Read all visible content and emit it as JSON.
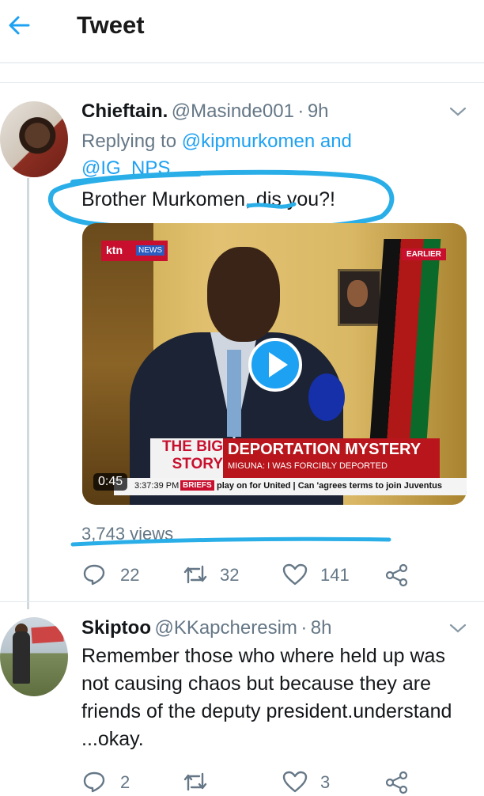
{
  "header": {
    "title": "Tweet",
    "back_icon": "arrow-left-icon",
    "accent": "#1da1f2"
  },
  "tweet1": {
    "name": "Chieftain.",
    "handle": "@Masinde001",
    "separator": "·",
    "time": "9h",
    "replying_prefix": "Replying to",
    "replying_to_1": "@kipmurkomen",
    "replying_and": "and",
    "replying_to_2": "@IG_NPS",
    "text": "Brother Murkomen, dis you?!",
    "video": {
      "duration": "0:45",
      "channel": "ktn",
      "channel_tag": "NEWS",
      "corner_label": "EARLIER",
      "big_story_1": "THE BIG",
      "big_story_2": "STORY",
      "headline": "DEPORTATION MYSTERY",
      "subheadline": "MIGUNA: I WAS FORCIBLY DEPORTED",
      "ticker_time": "3:37:39 PM",
      "ticker_tag": "BRIEFS",
      "ticker_text": "play on for United | Can 'agrees terms to join Juventus"
    },
    "views": "3,743 views",
    "replies": "22",
    "retweets": "32",
    "likes": "141"
  },
  "tweet2": {
    "name": "Skiptoo",
    "handle": "@KKapcheresim",
    "separator": "·",
    "time": "8h",
    "text": "Remember those who where held up was not causing chaos but because they are friends of the deputy president.understand ...okay.",
    "replies": "2",
    "retweets": "",
    "likes": "3"
  }
}
